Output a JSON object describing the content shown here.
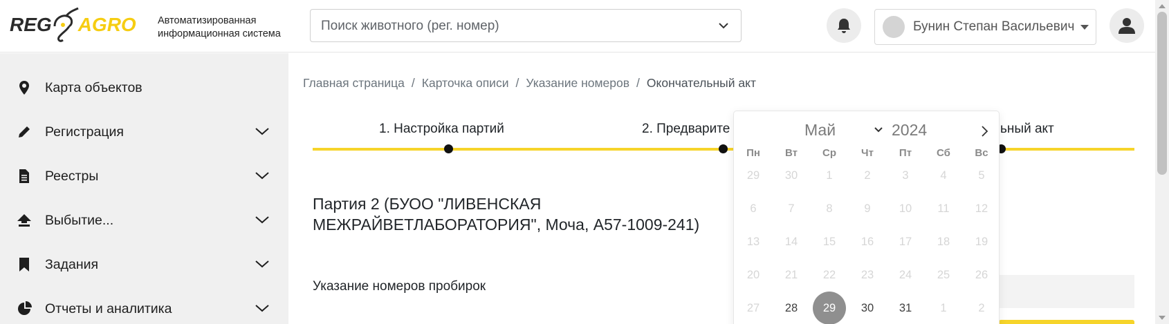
{
  "header": {
    "logo_reg": "REG",
    "logo_agro": "AGRO",
    "logo_subtitle_line1": "Автоматизированная",
    "logo_subtitle_line2": "информационная система",
    "search_placeholder": "Поиск животного (рег. номер)",
    "user_name": "Бунин Степан Васильевич"
  },
  "sidebar": {
    "items": [
      {
        "label": "Карта объектов",
        "icon": "map-marker-icon",
        "expandable": false
      },
      {
        "label": "Регистрация",
        "icon": "pencil-icon",
        "expandable": true
      },
      {
        "label": "Реестры",
        "icon": "document-icon",
        "expandable": true
      },
      {
        "label": "Выбытие...",
        "icon": "upload-icon",
        "expandable": true
      },
      {
        "label": "Задания",
        "icon": "bookmark-icon",
        "expandable": true
      },
      {
        "label": "Отчеты и аналитика",
        "icon": "pie-chart-icon",
        "expandable": true
      }
    ]
  },
  "breadcrumb": {
    "items": [
      "Главная страница",
      "Карточка описи",
      "Указание номеров"
    ],
    "current": "Окончательный акт"
  },
  "stepper": {
    "steps": [
      "1. Настройка партий",
      "2. Предварите",
      "ельный акт"
    ]
  },
  "main": {
    "party_title": "Партия 2 (БУОО \"ЛИВЕНСКАЯ МЕЖРАЙВЕТЛАБОРАТОРИЯ\", Моча, A57-1009-241)",
    "subtitle": "Указание номеров пробирок"
  },
  "calendar": {
    "month": "Май",
    "year": "2024",
    "weekdays": [
      "Пн",
      "Вт",
      "Ср",
      "Чт",
      "Пт",
      "Сб",
      "Вс"
    ],
    "rows": [
      [
        "29",
        "30",
        "1",
        "2",
        "3",
        "4",
        "5"
      ],
      [
        "6",
        "7",
        "8",
        "9",
        "10",
        "11",
        "12"
      ],
      [
        "13",
        "14",
        "15",
        "16",
        "17",
        "18",
        "19"
      ],
      [
        "20",
        "21",
        "22",
        "23",
        "24",
        "25",
        "26"
      ],
      [
        "27",
        "28",
        "29",
        "30",
        "31",
        "1",
        "2"
      ]
    ],
    "selected_day": "29"
  },
  "colors": {
    "accent_yellow": "#f6d42a",
    "sidebar_bg": "#f0f0f0",
    "selected_day_bg": "#8f8f8f"
  }
}
